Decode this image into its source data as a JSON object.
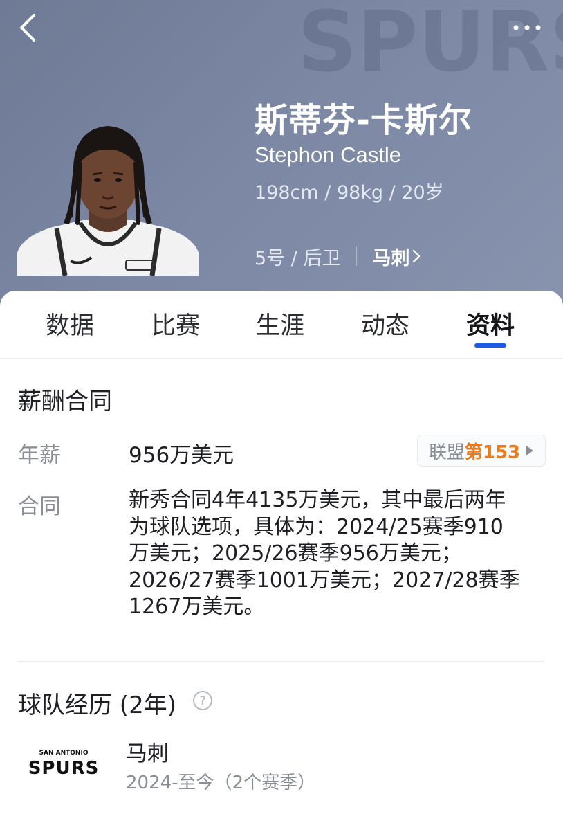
{
  "header": {
    "name_cn": "斯蒂芬-卡斯尔",
    "name_en": "Stephon Castle",
    "body_info": "198cm / 98kg / 20岁",
    "number_position": "5号 / 后卫",
    "team_link": "马刺",
    "bg_logo_text": "SPURS"
  },
  "tabs": [
    {
      "label": "数据"
    },
    {
      "label": "比赛"
    },
    {
      "label": "生涯"
    },
    {
      "label": "动态"
    },
    {
      "label": "资料",
      "active": true
    }
  ],
  "salary": {
    "title": "薪酬合同",
    "annual_label": "年薪",
    "annual_value": "956万美元",
    "rank_prefix": "联盟",
    "rank_value": "第153",
    "contract_label": "合同",
    "contract_lines": [
      "新秀合同4年4135万美元，其中最后两年",
      "为球队选项，具体为：2024/25赛季910",
      "万美元；2025/26赛季956万美元；",
      "2026/27赛季1001万美元；2027/28赛季",
      "1267万美元。"
    ]
  },
  "history": {
    "title": "球队经历 (2年)",
    "teams": [
      {
        "name": "马刺",
        "years": "2024-至今（2个赛季）",
        "logo_top": "SAN ANTONIO",
        "logo_main": "SPURS"
      }
    ]
  },
  "colors": {
    "hero_bg": "#7b87a3",
    "accent_blue": "#1f5ce6",
    "rank_orange": "#f07a16"
  },
  "icons": [
    "back-arrow-icon",
    "more-dots-icon",
    "chevron-right-icon",
    "triangle-right-icon",
    "help-circle-icon"
  ]
}
